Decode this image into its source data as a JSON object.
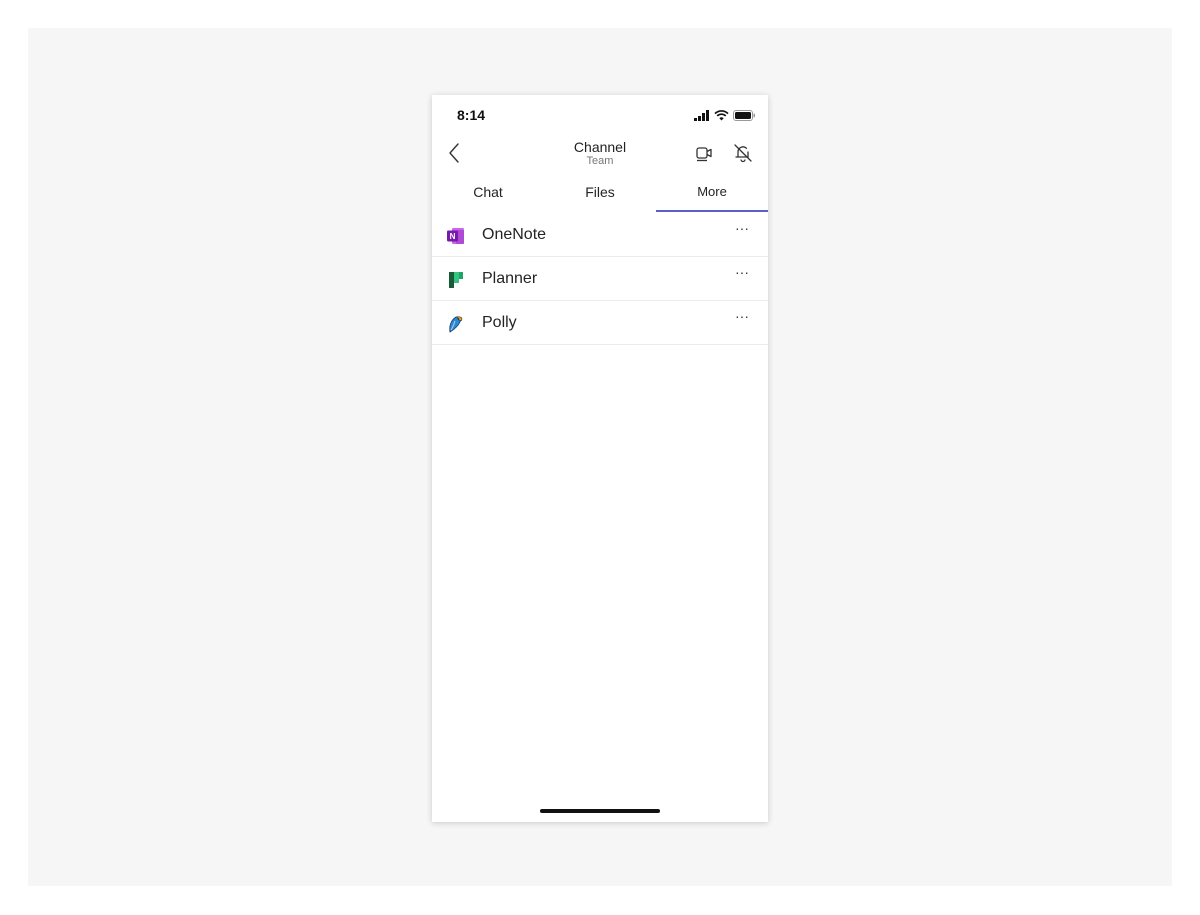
{
  "status_bar": {
    "time": "8:14",
    "icons": [
      "cellular-signal-icon",
      "wifi-icon",
      "battery-icon"
    ]
  },
  "header": {
    "title": "Channel",
    "subtitle": "Team",
    "back_icon": "chevron-left-icon",
    "actions": [
      "video-call-icon",
      "bell-off-icon"
    ]
  },
  "tabs": [
    {
      "label": "Chat",
      "active": false
    },
    {
      "label": "Files",
      "active": false
    },
    {
      "label": "More",
      "active": true
    }
  ],
  "apps": [
    {
      "name": "OneNote",
      "icon": "onenote-icon",
      "more": "···"
    },
    {
      "name": "Planner",
      "icon": "planner-icon",
      "more": "···"
    },
    {
      "name": "Polly",
      "icon": "polly-icon",
      "more": "···"
    }
  ],
  "colors": {
    "accent": "#5b5fc7",
    "onenote": "#7719aa",
    "planner": "#31752f"
  }
}
